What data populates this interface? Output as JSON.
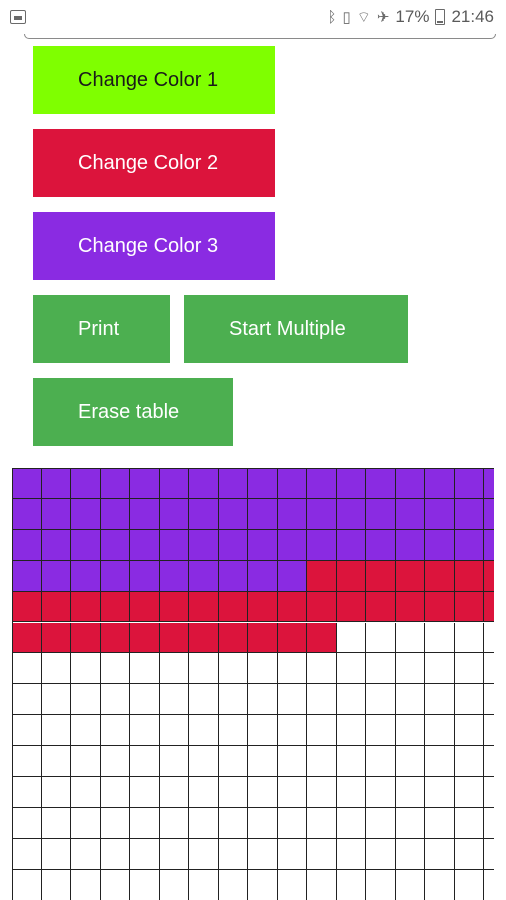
{
  "status_bar": {
    "icons": [
      "notification-icon",
      "bluetooth-icon",
      "vibrate-icon",
      "wifi-icon",
      "airplane-icon",
      "battery-icon"
    ],
    "battery": "17%",
    "time": "21:46"
  },
  "buttons": {
    "color1": {
      "label": "Change Color 1",
      "bg": "#7fff00",
      "fg": "#1a1a1a"
    },
    "color2": {
      "label": "Change Color 2",
      "bg": "#dc143c",
      "fg": "#ffffff"
    },
    "color3": {
      "label": "Change Color 3",
      "bg": "#8a2be2",
      "fg": "#ffffff"
    },
    "print": {
      "label": "Print",
      "bg": "#4caf50",
      "fg": "#ffffff"
    },
    "start_multiple": {
      "label": "Start Multiple",
      "bg": "#4caf50",
      "fg": "#ffffff"
    },
    "erase": {
      "label": "Erase table",
      "bg": "#4caf50",
      "fg": "#ffffff"
    }
  },
  "table": {
    "columns": 17,
    "rows": 14,
    "colors": {
      "purple": "#8a2be2",
      "red": "#dc143c",
      "empty": "#ffffff"
    },
    "filled": [
      {
        "row": 0,
        "purple_cols": 17,
        "red_cols": 0
      },
      {
        "row": 1,
        "purple_cols": 17,
        "red_cols": 0
      },
      {
        "row": 2,
        "purple_cols": 17,
        "red_cols": 0
      },
      {
        "row": 3,
        "purple_cols": 10,
        "red_cols": 7
      },
      {
        "row": 4,
        "purple_cols": 0,
        "red_cols": 17
      },
      {
        "row": 5,
        "purple_cols": 0,
        "red_cols": 11
      }
    ]
  }
}
